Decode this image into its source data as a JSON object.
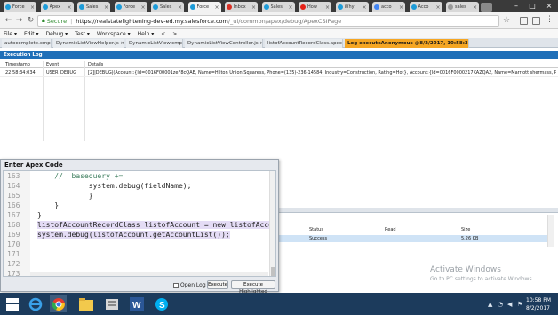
{
  "browser": {
    "tabs": [
      {
        "label": "Force",
        "close": "×",
        "color": "#1d9bd8"
      },
      {
        "label": "Apex",
        "close": "×",
        "color": "#1d9bd8"
      },
      {
        "label": "Sales",
        "close": "×",
        "color": "#1d9bd8"
      },
      {
        "label": "Force",
        "close": "×",
        "color": "#1d9bd8"
      },
      {
        "label": "Sales",
        "close": "×",
        "color": "#1d9bd8"
      },
      {
        "label": "Force",
        "close": "×",
        "color": "#1d9bd8"
      },
      {
        "label": "Inbox",
        "close": "×",
        "color": "#d93025"
      },
      {
        "label": "Sales",
        "close": "×",
        "color": "#1d9bd8"
      },
      {
        "label": "How",
        "close": "×",
        "color": "#e62117"
      },
      {
        "label": "Why",
        "close": "×",
        "color": "#1d9bd8"
      },
      {
        "label": "acco",
        "close": "×",
        "color": "#4285f4"
      },
      {
        "label": "Acco",
        "close": "×",
        "color": "#1d9bd8"
      },
      {
        "label": "sales",
        "close": "×",
        "color": "#999999"
      }
    ],
    "window_controls": [
      "–",
      "□",
      "×"
    ],
    "address": {
      "secure_label": "Secure",
      "separator": "|",
      "url_host": "https://realstatelightening-dev-ed.my.salesforce.com",
      "url_path": "/_ui/common/apex/debug/ApexCSIPage"
    }
  },
  "console": {
    "menu": [
      "File ▾",
      "Edit ▾",
      "Debug ▾",
      "Test ▾",
      "Workspace ▾",
      "Help ▾",
      "<",
      ">"
    ],
    "file_tabs": [
      {
        "label": "autocomplete.cmp ×"
      },
      {
        "label": "DynamicListViewHelper.js ×"
      },
      {
        "label": "DynamicListView.cmp ×"
      },
      {
        "label": "DynamicListViewController.js ×"
      },
      {
        "label": "listofAccountRecordClass.apxc ×"
      },
      {
        "label": "Log executeAnonymous @8/2/2017, 10:58:34 PM ×"
      }
    ],
    "execution_log": {
      "title": "Execution Log",
      "columns": [
        "Timestamp",
        "Event",
        "Details"
      ],
      "row": {
        "timestamp": "22:58:34:034",
        "event": "USER_DEBUG",
        "details": "[2]|DEBUG|(Account:{Id=0016F00001zeF8cQAE, Name=Hilton Union Squaress, Phone=(135)-236-14584, Industry=Construction, Rating=Hot}, Account:{Id=0016F0000217KAZQA2, Name=Marriott shermass, Phone=25642648979, Indu"
      }
    },
    "results": {
      "columns": [
        "Status",
        "Read",
        "Size"
      ],
      "row": {
        "status": "Success",
        "read": "",
        "size": "5.26 KB"
      }
    }
  },
  "apex_dialog": {
    "title": "Enter Apex Code",
    "lines": [
      {
        "num": "163",
        "code": "    //  basequery +="
      },
      {
        "num": "164",
        "code": "            system.debug(fieldName);"
      },
      {
        "num": "165",
        "code": "            }"
      },
      {
        "num": "166",
        "code": "    }"
      },
      {
        "num": "167",
        "code": "}"
      },
      {
        "num": "168",
        "code": "listofAccountRecordClass listofAccount = new listofAccount"
      },
      {
        "num": "169",
        "code": "system.debug(listofAccount.getAccountList());"
      },
      {
        "num": "170",
        "code": ""
      },
      {
        "num": "171",
        "code": ""
      },
      {
        "num": "172",
        "code": ""
      },
      {
        "num": "173",
        "code": ""
      }
    ],
    "open_log_label": "Open Log",
    "execute_label": "Execute",
    "execute_highlighted_label": "Execute Highlighted"
  },
  "watermark": {
    "title": "Activate Windows",
    "subtitle": "Go to PC settings to activate Windows."
  },
  "taskbar": {
    "time": "10:58 PM",
    "date": "8/2/2017",
    "color": "#1c3b5c"
  }
}
